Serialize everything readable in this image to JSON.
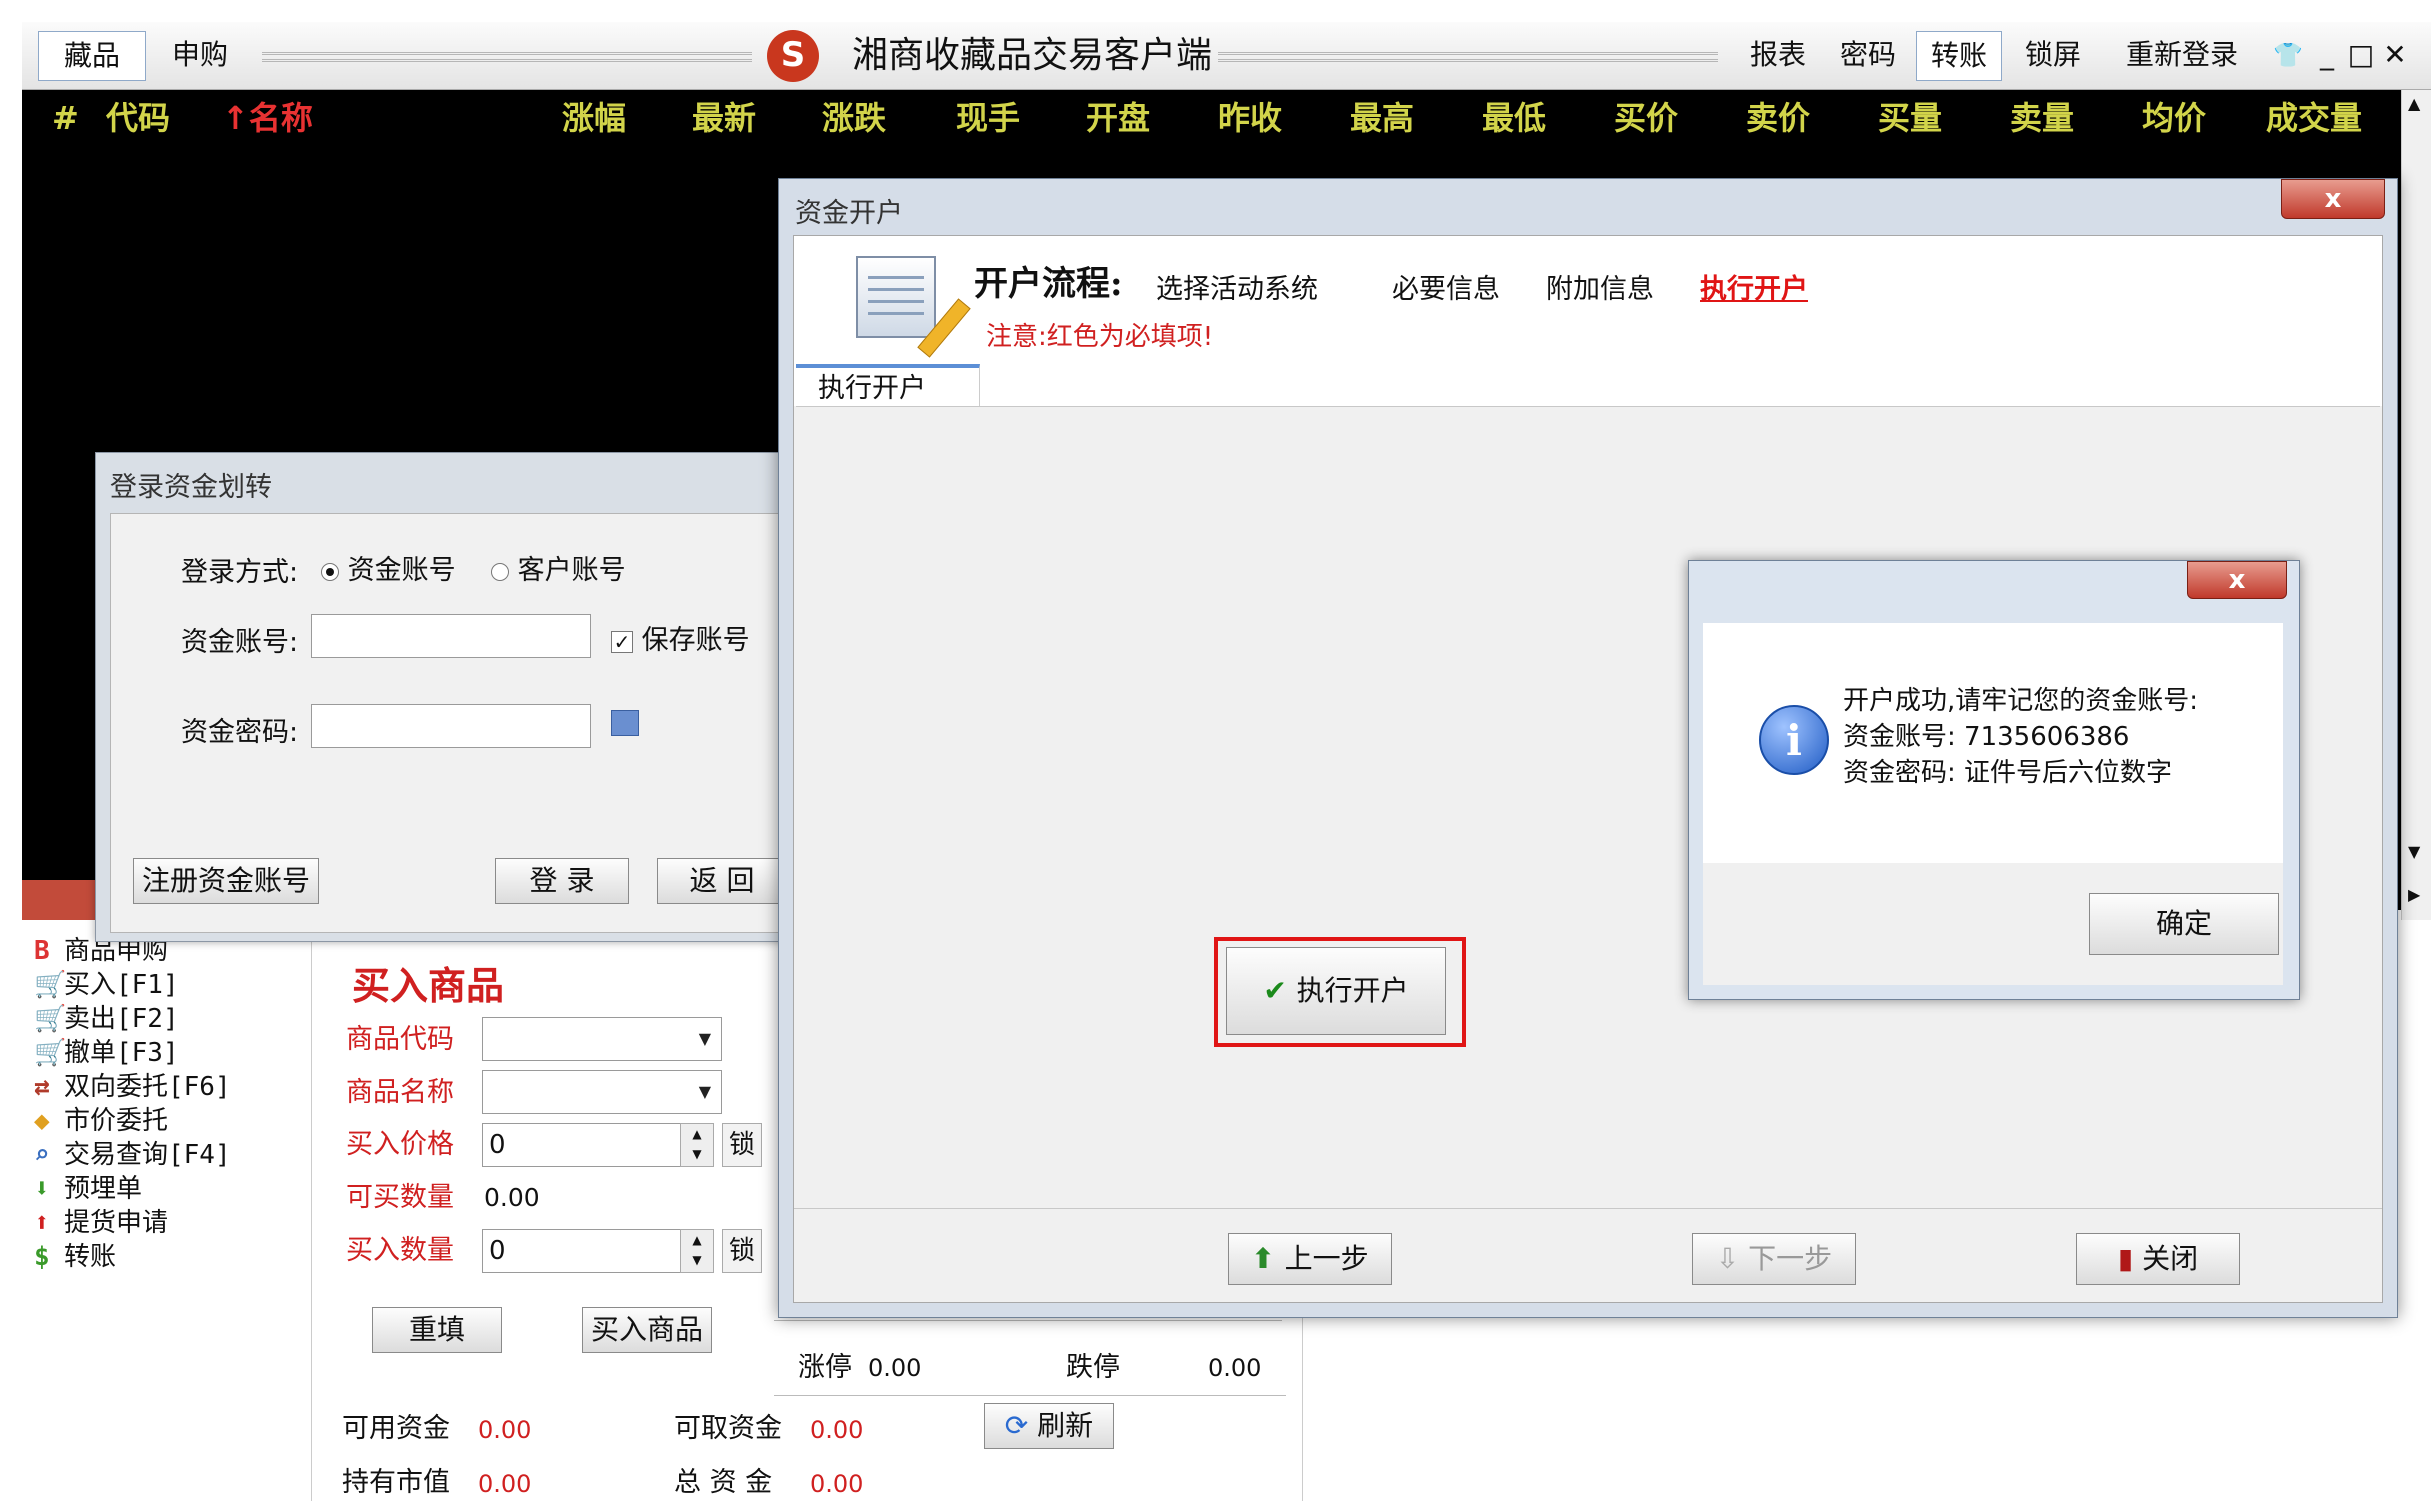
{
  "topbar": {
    "left_tabs": [
      "藏品",
      "申购"
    ],
    "app_title": "湘商收藏品交易客户端",
    "menu": [
      "报表",
      "密码",
      "转账",
      "锁屏",
      "重新登录"
    ],
    "selected_menu": "转账",
    "window_controls": [
      "pin-icon",
      "minimize-icon",
      "maximize-icon",
      "close-icon"
    ]
  },
  "market_table": {
    "columns": [
      "#",
      "代码",
      "↑名称",
      "涨幅",
      "最新",
      "涨跌",
      "现手",
      "开盘",
      "昨收",
      "最高",
      "最低",
      "买价",
      "卖价",
      "买量",
      "卖量",
      "均价",
      "成交量"
    ]
  },
  "left_nav": {
    "items": [
      {
        "icon": "B",
        "label": "商品申购"
      },
      {
        "icon": "cart-buy-icon",
        "label": "买入[F1]"
      },
      {
        "icon": "cart-sell-icon",
        "label": "卖出[F2]"
      },
      {
        "icon": "cart-cancel-icon",
        "label": "撤单[F3]"
      },
      {
        "icon": "two-way-icon",
        "label": "双向委托[F6]"
      },
      {
        "icon": "market-order-icon",
        "label": "市价委托"
      },
      {
        "icon": "search-icon",
        "label": "交易查询[F4]"
      },
      {
        "icon": "pre-order-icon",
        "label": "预埋单"
      },
      {
        "icon": "arrow-up-icon",
        "label": "提货申请"
      },
      {
        "icon": "dollar-icon",
        "label": "转账"
      }
    ]
  },
  "buy_panel": {
    "title": "买入商品",
    "code_label": "商品代码",
    "name_label": "商品名称",
    "price_label": "买入价格",
    "price_value": "0",
    "available_label": "可买数量",
    "available_value": "0.00",
    "qty_label": "买入数量",
    "qty_value": "0",
    "lock_label": "锁",
    "reset_button": "重填",
    "buy_button": "买入商品",
    "limit_up_label": "涨停",
    "limit_up_value": "0.00",
    "limit_down_label": "跌停",
    "limit_down_value": "0.00",
    "refresh_button": "刷新",
    "funds_available_label": "可用资金",
    "funds_available_value": "0.00",
    "funds_withdrawable_label": "可取资金",
    "funds_withdrawable_value": "0.00",
    "holdings_label": "持有市值",
    "holdings_value": "0.00",
    "total_label": "总 资 金",
    "total_value": "0.00"
  },
  "login_dialog": {
    "title": "登录资金划转",
    "mode_label": "登录方式:",
    "mode_options": [
      "资金账号",
      "客户账号"
    ],
    "mode_selected": "资金账号",
    "account_label": "资金账号:",
    "account_value": "",
    "save_account_label": "保存账号",
    "save_account_checked": true,
    "password_label": "资金密码:",
    "register_button": "注册资金账号",
    "login_button": "登 录",
    "back_button": "返 回"
  },
  "account_dialog": {
    "title": "资金开户",
    "close_label": "x",
    "flow_label": "开户流程:",
    "steps": [
      "选择活动系统",
      "必要信息",
      "附加信息",
      "执行开户"
    ],
    "active_step": "执行开户",
    "note": "注意:红色为必填项!",
    "tab": "执行开户",
    "execute_button": "执行开户",
    "prev_button": "上一步",
    "next_button": "下一步",
    "close_button": "关闭"
  },
  "success_message": {
    "close_label": "x",
    "lines": [
      "开户成功,请牢记您的资金账号:",
      "资金账号: 7135606386",
      "资金密码: 证件号后六位数字"
    ],
    "ok_button": "确定"
  },
  "colors": {
    "market_bg": "#000000",
    "column_header": "#d2d44a",
    "red_label": "#d02020",
    "highlight_frame": "#e01515"
  }
}
